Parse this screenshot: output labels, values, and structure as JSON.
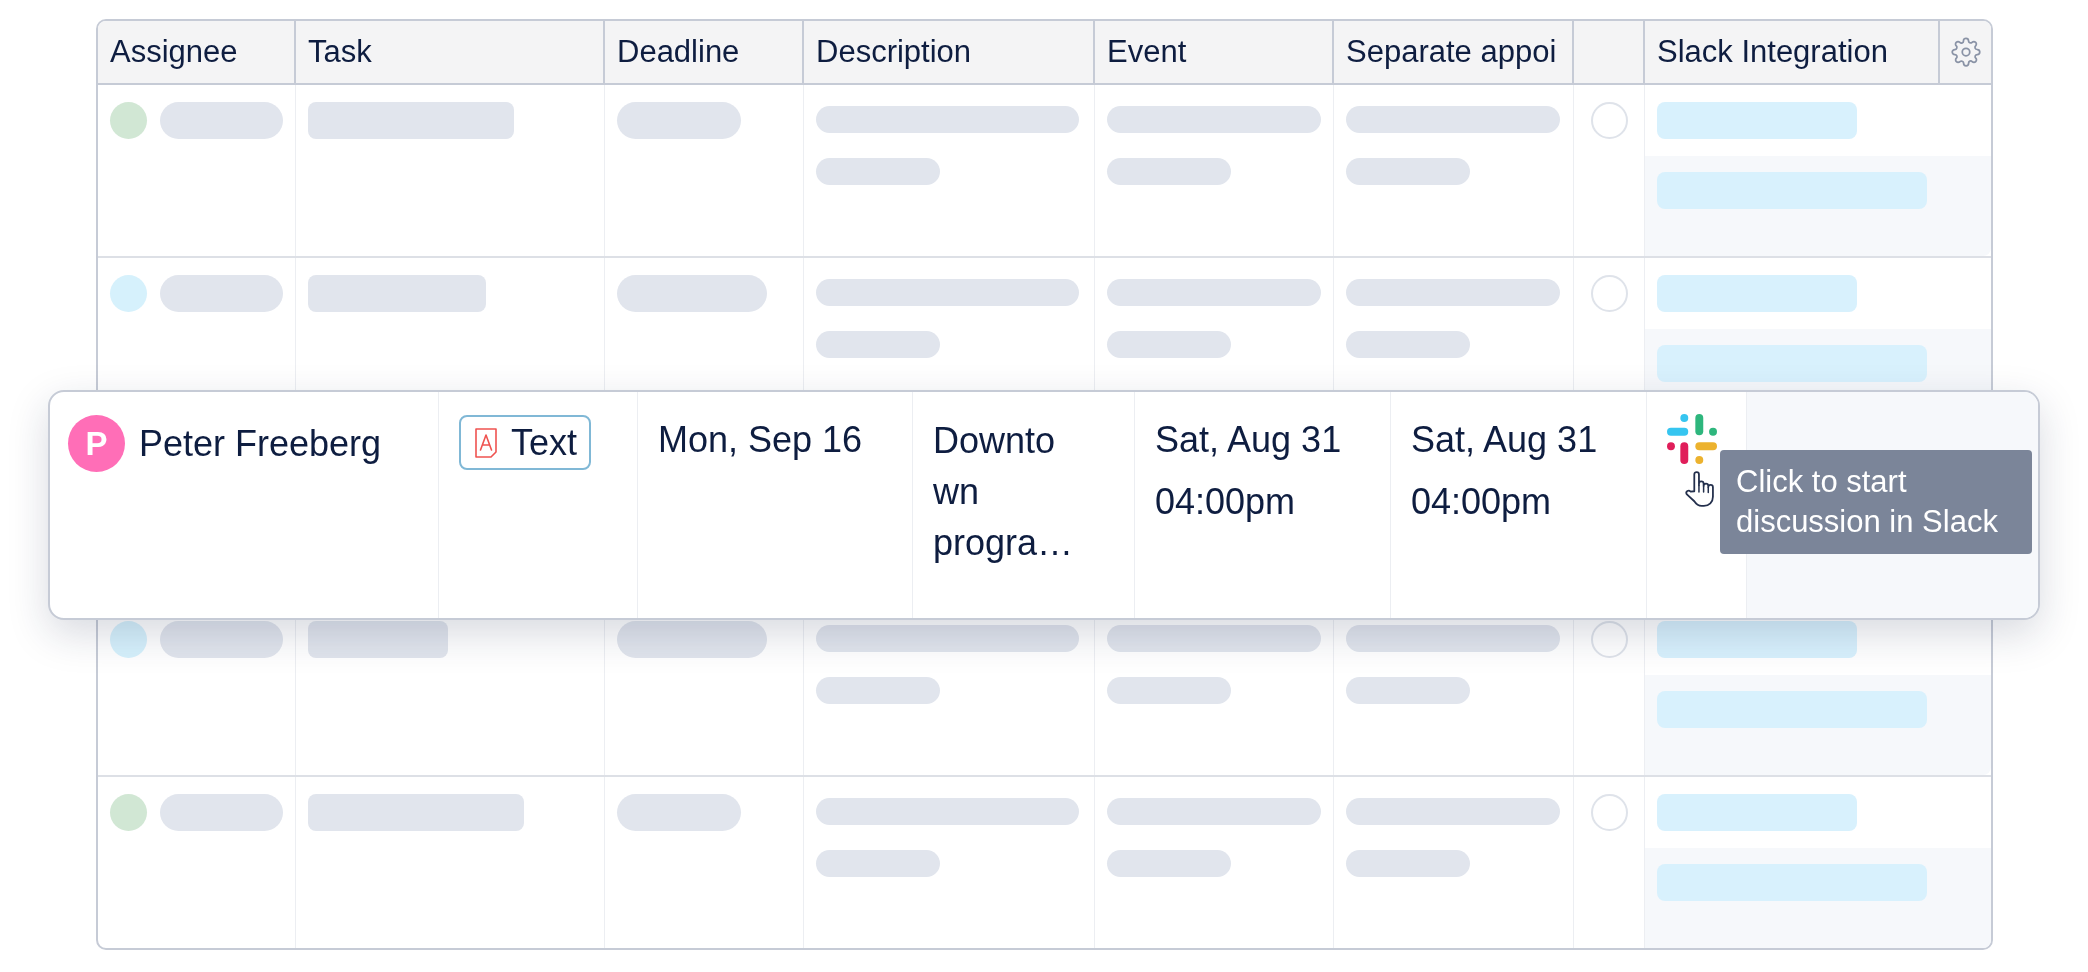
{
  "table": {
    "columns": [
      {
        "kind": "label",
        "label": "Assignee"
      },
      {
        "kind": "label",
        "label": "Task"
      },
      {
        "kind": "label",
        "label": "Deadline"
      },
      {
        "kind": "label",
        "label": "Description"
      },
      {
        "kind": "label",
        "label": "Event"
      },
      {
        "kind": "label",
        "label": "Separate appoi"
      },
      {
        "kind": "blank"
      },
      {
        "kind": "label",
        "label": "Slack Integration"
      },
      {
        "kind": "settings"
      }
    ],
    "rows": [
      {
        "kind": "skeleton",
        "color": "#d1e7d4",
        "checked": false
      },
      {
        "kind": "skeleton",
        "color": "#d6f1fc",
        "checked": false
      },
      {
        "kind": "dragged",
        "assignee": {
          "initial": "P",
          "name": "Peter Freeberg"
        },
        "task_type": "Text",
        "deadline": "Mon, Sep 16",
        "description": "Downtown progra…",
        "event": {
          "date": "Sat, Aug 31",
          "time": "04:00pm"
        },
        "separate_appointment": {
          "date": "Sat, Aug 31",
          "time": "04:00pm"
        },
        "slack": {
          "tooltip": "Click to start discussion in Slack"
        }
      },
      {
        "kind": "skeleton",
        "color": "#d6f1fc",
        "checked": false
      },
      {
        "kind": "skeleton",
        "color": "#d1e7d4",
        "checked": false
      }
    ]
  }
}
